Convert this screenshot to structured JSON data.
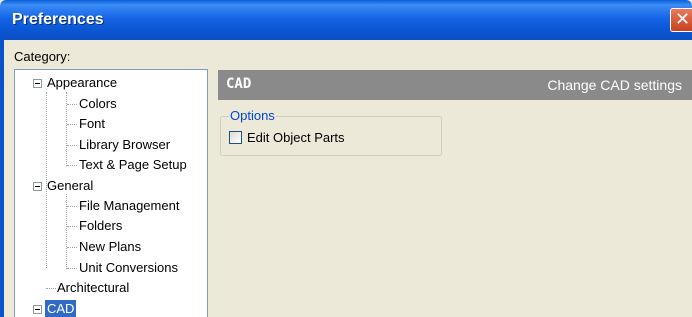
{
  "window": {
    "title": "Preferences",
    "close_glyph": "✕"
  },
  "category_label": "Category:",
  "tree": {
    "appearance": {
      "label": "Appearance",
      "children": [
        "Colors",
        "Font",
        "Library Browser",
        "Text & Page Setup"
      ]
    },
    "general": {
      "label": "General",
      "children": [
        "File Management",
        "Folders",
        "New Plans",
        "Unit Conversions"
      ]
    },
    "architectural": "Architectural",
    "cad": "CAD"
  },
  "panel": {
    "title": "CAD",
    "subtitle": "Change CAD settings",
    "options_group": "Options",
    "edit_object_parts": "Edit Object Parts",
    "edit_object_parts_checked": false
  },
  "colors": {
    "title_bar": "#0a5fd8",
    "header": "#8a8a8a",
    "selection": "#316ac5",
    "group_legend": "#0046d5"
  },
  "icons": {
    "close": "close-icon",
    "expander": "minus-expander-icon"
  }
}
